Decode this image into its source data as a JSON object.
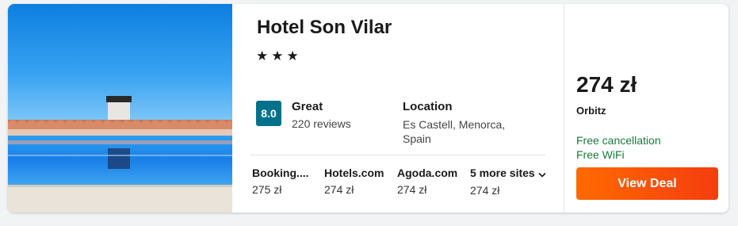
{
  "hotel": {
    "name": "Hotel Son Vilar",
    "stars": "★★★",
    "star_count": 3
  },
  "rating": {
    "score": "8.0",
    "label": "Great",
    "reviews": "220 reviews"
  },
  "location": {
    "label": "Location",
    "value": "Es Castell, Menorca, Spain"
  },
  "sites": [
    {
      "name": "Booking....",
      "price": "275 zł"
    },
    {
      "name": "Hotels.com",
      "price": "274 zł"
    },
    {
      "name": "Agoda.com",
      "price": "274 zł"
    },
    {
      "name": "5 more sites",
      "price": "274 zł"
    }
  ],
  "deal": {
    "price": "274 zł",
    "provider": "Orbitz",
    "features": [
      "Free cancellation",
      "Free WiFi"
    ],
    "button_label": "View Deal"
  },
  "colors": {
    "score_badge": "#00718a",
    "feature_text": "#1a7a3c",
    "button": "#f5500f"
  }
}
